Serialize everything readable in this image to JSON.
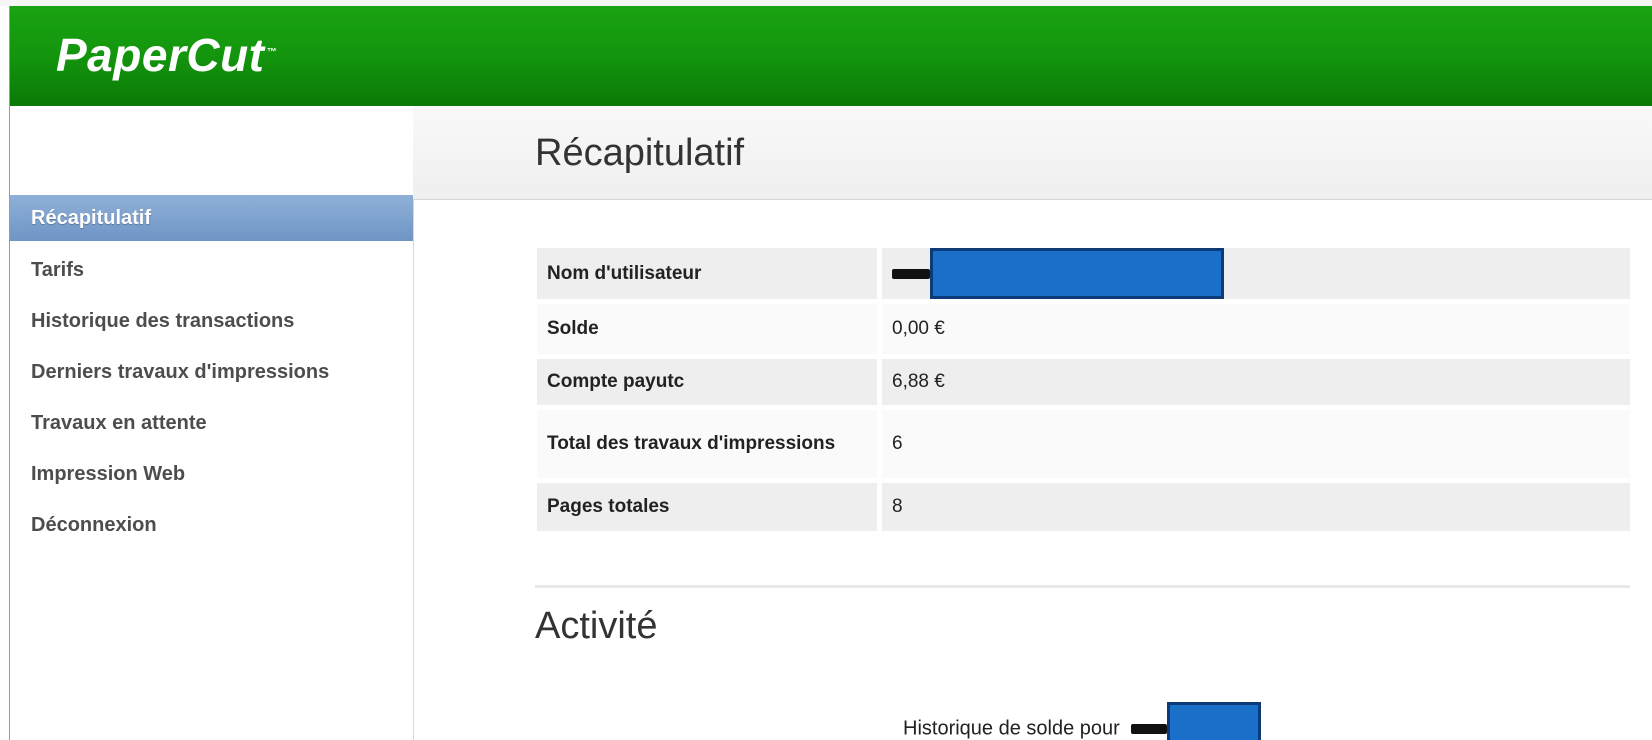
{
  "app": {
    "logo_text": "PaperCut",
    "logo_tm": "™",
    "brand_color": "#13950d"
  },
  "sidebar": {
    "items": [
      {
        "label": "Récapitulatif",
        "active": true
      },
      {
        "label": "Tarifs"
      },
      {
        "label": "Historique des transactions"
      },
      {
        "label": "Derniers travaux d'impressions"
      },
      {
        "label": "Travaux en attente"
      },
      {
        "label": "Impression Web"
      },
      {
        "label": "Déconnexion"
      }
    ],
    "active_color": "#7a9ecc"
  },
  "main": {
    "title": "Récapitulatif",
    "summary": {
      "rows": [
        {
          "label": "Nom d'utilisateur",
          "value": "",
          "redacted": true
        },
        {
          "label": "Solde",
          "value": "0,00 €"
        },
        {
          "label": "Compte payutc",
          "value": "6,88 €"
        },
        {
          "label": "Total des travaux d'impressions",
          "value": "6"
        },
        {
          "label": "Pages totales",
          "value": "8"
        }
      ]
    },
    "activity": {
      "title": "Activité",
      "chart_title": "Historique de solde pour"
    }
  }
}
